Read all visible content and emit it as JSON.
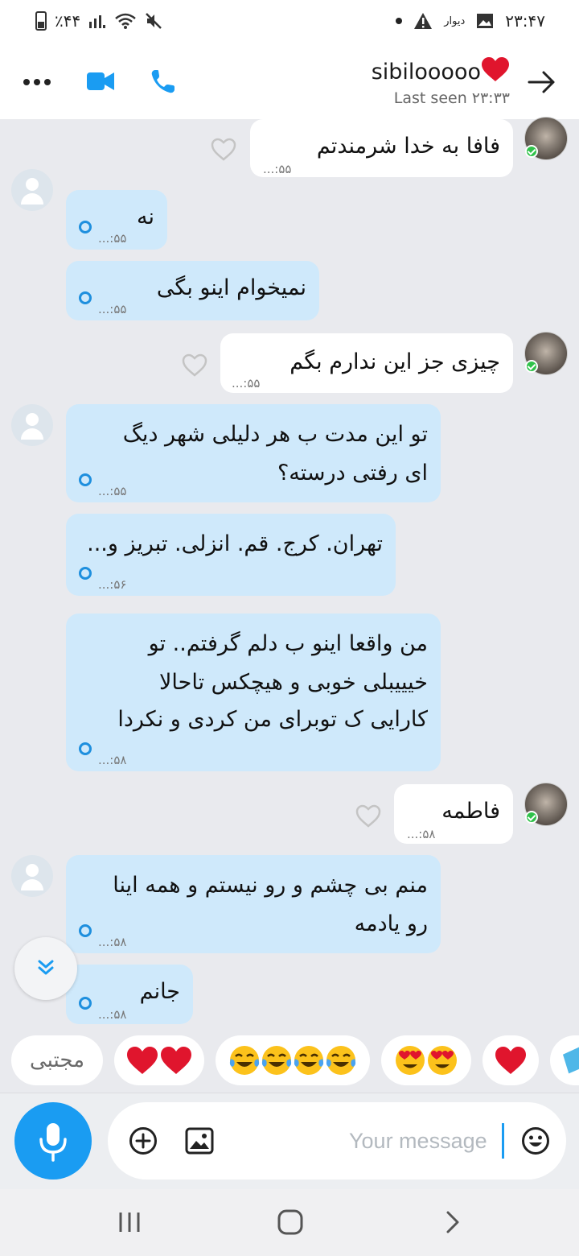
{
  "status_bar": {
    "battery_text": "٪۴۴",
    "clock": "۲۳:۴۷",
    "app_label": "دیوار"
  },
  "header": {
    "contact_name": "sibilooooo",
    "last_seen": "Last seen ۲۳:۳۳"
  },
  "messages": [
    {
      "direction": "in",
      "text": "فافا به خدا شرمندتم",
      "time": "...:۵۵"
    },
    {
      "direction": "out",
      "text": "نه",
      "time": "...:۵۵"
    },
    {
      "direction": "out",
      "text": "نمیخوام اینو بگی",
      "time": "...:۵۵"
    },
    {
      "direction": "in",
      "text": "چیزی جز این ندارم بگم",
      "time": "...:۵۵"
    },
    {
      "direction": "out",
      "line1": "تو این مدت ب هر دلیلی شهر دیگ",
      "line2": "ای رفتی درسته؟",
      "time": "...:۵۵"
    },
    {
      "direction": "out",
      "text": "تهران. کرج. قم. انزلی. تبریز و...",
      "time": "...:۵۶"
    },
    {
      "direction": "out",
      "line1": "من واقعا اینو ب دلم گرفتم.. تو",
      "line2": "خیییبلی خوبی و هیچکس تاحالا",
      "line3": "کارایی ک توبرای من کردی و نکردا",
      "time": "...:۵۸"
    },
    {
      "direction": "in",
      "text": "فاطمه",
      "time": "...:۵۸"
    },
    {
      "direction": "out",
      "line1": "منم بی چشم و رو نیستم و همه اینا",
      "line2": "رو یادمه",
      "time": "...:۵۸"
    },
    {
      "direction": "out",
      "text": "جانم",
      "time": "...:۵۸"
    }
  ],
  "quick_replies": {
    "text_chip": "مجتبی",
    "chips": [
      "hearts-x2",
      "tears-of-joy-x4",
      "heart-eyes-x2",
      "heart-x1",
      "gift-partial"
    ]
  },
  "composer": {
    "placeholder": "Your message"
  },
  "colors": {
    "accent": "#1a9cf2",
    "outgoing_bubble": "#cfe9fb",
    "incoming_bubble": "#ffffff",
    "background": "#e9eaee",
    "online": "#2fc24a"
  }
}
